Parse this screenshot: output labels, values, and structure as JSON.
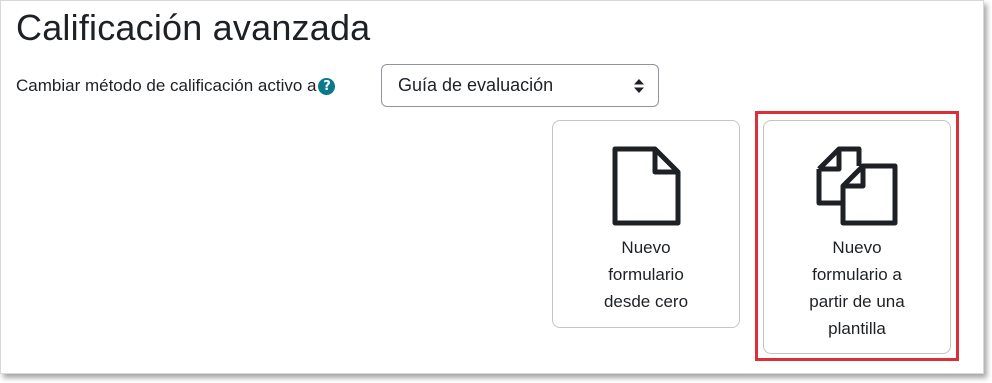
{
  "page": {
    "title": "Calificación avanzada"
  },
  "method": {
    "label": "Cambiar método de calificación activo a",
    "help_icon": "question-circle-icon",
    "selected": "Guía de evaluación"
  },
  "cards": {
    "blank": {
      "icon": "file-icon",
      "line1": "Nuevo",
      "line2": "formulario",
      "line3": "desde cero"
    },
    "template": {
      "icon": "copy-files-icon",
      "line1": "Nuevo",
      "line2": "formulario a",
      "line3": "partir de una",
      "line4": "plantilla"
    }
  },
  "colors": {
    "help_icon": "#0a7a8a",
    "highlight": "#d9303a",
    "text": "#1d2125"
  }
}
